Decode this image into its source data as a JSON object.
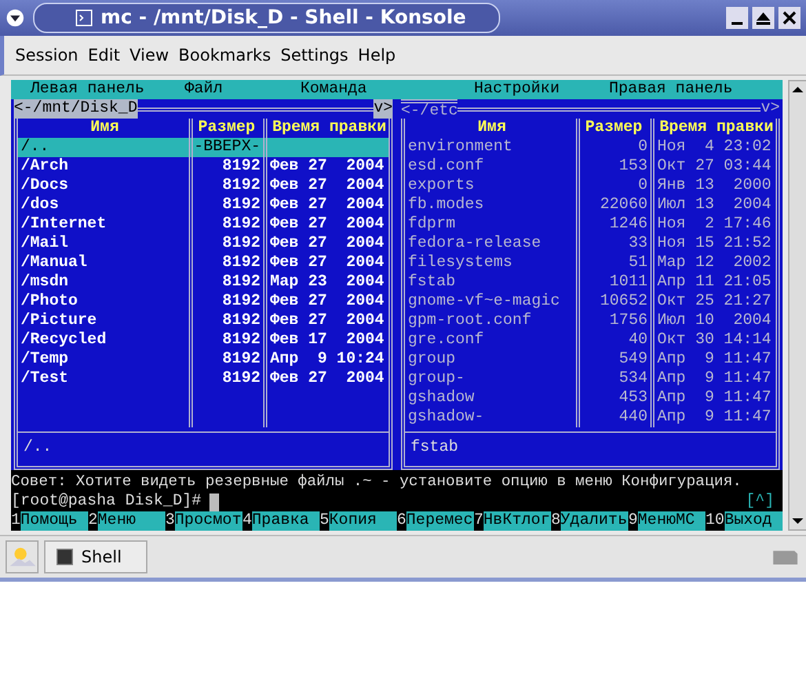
{
  "window": {
    "title": "mc - /mnt/Disk_D - Shell - Konsole"
  },
  "menubar": [
    "Session",
    "Edit",
    "View",
    "Bookmarks",
    "Settings",
    "Help"
  ],
  "mc": {
    "top_menu": [
      "Левая панель",
      "Файл",
      "Команда",
      "Настройки",
      "Правая панель"
    ],
    "panels": [
      {
        "path": "<-/mnt/Disk_D",
        "corner": "v>",
        "active": true,
        "columns": [
          "Имя",
          "Размер",
          "Время правки"
        ],
        "status": "/..",
        "rows": [
          {
            "name": "/..",
            "size": "-ВВЕРХ-",
            "modified": "",
            "kind": "dir",
            "selected": true
          },
          {
            "name": "/Arch",
            "size": "8192",
            "modified": "Фев 27  2004",
            "kind": "dir",
            "selected": false
          },
          {
            "name": "/Docs",
            "size": "8192",
            "modified": "Фев 27  2004",
            "kind": "dir",
            "selected": false
          },
          {
            "name": "/dos",
            "size": "8192",
            "modified": "Фев 27  2004",
            "kind": "dir",
            "selected": false
          },
          {
            "name": "/Internet",
            "size": "8192",
            "modified": "Фев 27  2004",
            "kind": "dir",
            "selected": false
          },
          {
            "name": "/Mail",
            "size": "8192",
            "modified": "Фев 27  2004",
            "kind": "dir",
            "selected": false
          },
          {
            "name": "/Manual",
            "size": "8192",
            "modified": "Фев 27  2004",
            "kind": "dir",
            "selected": false
          },
          {
            "name": "/msdn",
            "size": "8192",
            "modified": "Мар 23  2004",
            "kind": "dir",
            "selected": false
          },
          {
            "name": "/Photo",
            "size": "8192",
            "modified": "Фев 27  2004",
            "kind": "dir",
            "selected": false
          },
          {
            "name": "/Picture",
            "size": "8192",
            "modified": "Фев 27  2004",
            "kind": "dir",
            "selected": false
          },
          {
            "name": "/Recycled",
            "size": "8192",
            "modified": "Фев 17  2004",
            "kind": "dir",
            "selected": false
          },
          {
            "name": "/Temp",
            "size": "8192",
            "modified": "Апр  9 10:24",
            "kind": "dir",
            "selected": false
          },
          {
            "name": "/Test",
            "size": "8192",
            "modified": "Фев 27  2004",
            "kind": "dir",
            "selected": false
          }
        ]
      },
      {
        "path": "<-/etc",
        "corner": "v>",
        "active": false,
        "columns": [
          "Имя",
          "Размер",
          "Время правки"
        ],
        "status": "fstab",
        "rows": [
          {
            "name": "environment",
            "size": "0",
            "modified": "Ноя  4 23:02",
            "kind": "file",
            "selected": false
          },
          {
            "name": "esd.conf",
            "size": "153",
            "modified": "Окт 27 03:44",
            "kind": "file",
            "selected": false
          },
          {
            "name": "exports",
            "size": "0",
            "modified": "Янв 13  2000",
            "kind": "file",
            "selected": false
          },
          {
            "name": "fb.modes",
            "size": "22060",
            "modified": "Июл 13  2004",
            "kind": "file",
            "selected": false
          },
          {
            "name": "fdprm",
            "size": "1246",
            "modified": "Ноя  2 17:46",
            "kind": "file",
            "selected": false
          },
          {
            "name": "fedora-release",
            "size": "33",
            "modified": "Ноя 15 21:52",
            "kind": "file",
            "selected": false
          },
          {
            "name": "filesystems",
            "size": "51",
            "modified": "Мар 12  2002",
            "kind": "file",
            "selected": false
          },
          {
            "name": "fstab",
            "size": "1011",
            "modified": "Апр 11 21:05",
            "kind": "file",
            "selected": false
          },
          {
            "name": "gnome-vf~e-magic",
            "size": "10652",
            "modified": "Окт 25 21:27",
            "kind": "file",
            "selected": false
          },
          {
            "name": "gpm-root.conf",
            "size": "1756",
            "modified": "Июл 10  2004",
            "kind": "file",
            "selected": false
          },
          {
            "name": "gre.conf",
            "size": "40",
            "modified": "Окт 30 14:14",
            "kind": "file",
            "selected": false
          },
          {
            "name": "group",
            "size": "549",
            "modified": "Апр  9 11:47",
            "kind": "file",
            "selected": false
          },
          {
            "name": "group-",
            "size": "534",
            "modified": "Апр  9 11:47",
            "kind": "file",
            "selected": false
          },
          {
            "name": "gshadow",
            "size": "453",
            "modified": "Апр  9 11:47",
            "kind": "file",
            "selected": false
          },
          {
            "name": "gshadow-",
            "size": "440",
            "modified": "Апр  9 11:47",
            "kind": "file",
            "selected": false
          }
        ]
      }
    ],
    "hint": "Совет: Хотите видеть резервные файлы .~ - установите опцию в меню Конфигурация.",
    "prompt": "[root@pasha Disk_D]#",
    "history_marker": "[^]",
    "keybar": [
      {
        "number": "1",
        "label": "Помощь"
      },
      {
        "number": "2",
        "label": "Меню"
      },
      {
        "number": "3",
        "label": "Просмот"
      },
      {
        "number": "4",
        "label": "Правка"
      },
      {
        "number": "5",
        "label": "Копия"
      },
      {
        "number": "6",
        "label": "Перемес"
      },
      {
        "number": "7",
        "label": "НвКтлог"
      },
      {
        "number": "8",
        "label": "Удалить"
      },
      {
        "number": "9",
        "label": "МенюМС"
      },
      {
        "number": "10",
        "label": "Выход"
      }
    ]
  },
  "taskbar": {
    "tasks": [
      "Shell"
    ]
  }
}
